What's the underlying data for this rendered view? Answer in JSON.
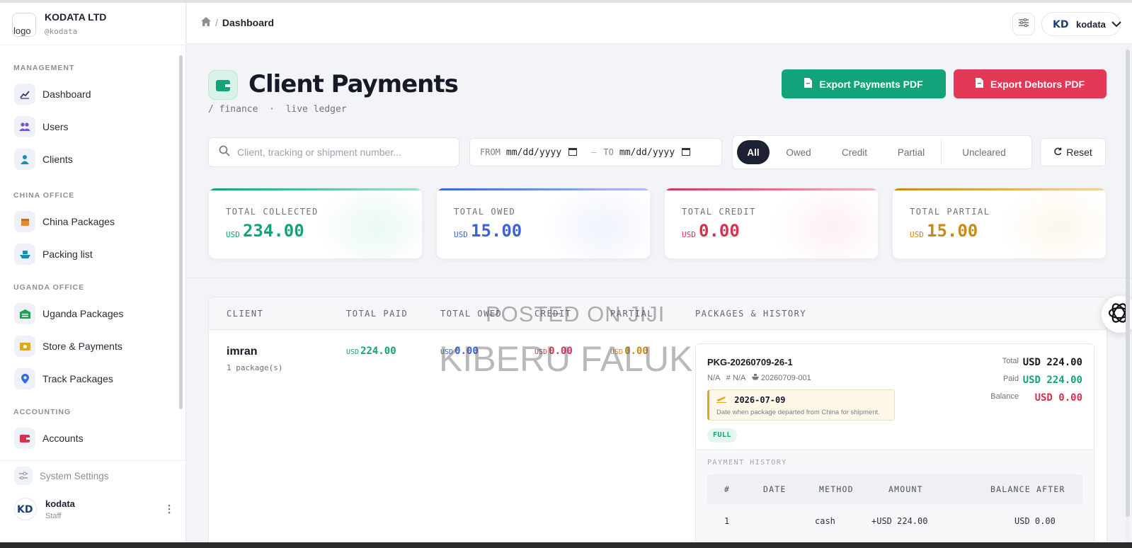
{
  "brand": {
    "logo_alt": "logo",
    "name": "KODATA LTD",
    "handle": "@kodata"
  },
  "sidebar": {
    "sections": [
      "MANAGEMENT",
      "CHINA OFFICE",
      "UGANDA OFFICE",
      "ACCOUNTING"
    ],
    "items": [
      {
        "label": "Dashboard",
        "icon": "chart-line-icon"
      },
      {
        "label": "Users",
        "icon": "users-icon"
      },
      {
        "label": "Clients",
        "icon": "user-icon"
      },
      {
        "label": "China Packages",
        "icon": "box-icon"
      },
      {
        "label": "Packing list",
        "icon": "ship-icon"
      },
      {
        "label": "Uganda Packages",
        "icon": "warehouse-icon"
      },
      {
        "label": "Store & Payments",
        "icon": "money-icon"
      },
      {
        "label": "Track Packages",
        "icon": "location-pin-icon"
      },
      {
        "label": "Accounts",
        "icon": "wallet-icon"
      }
    ],
    "settings_label": "System Settings",
    "user": {
      "name": "kodata",
      "role": "Staff"
    }
  },
  "header": {
    "breadcrumb": "Dashboard",
    "account_name": "kodata"
  },
  "page": {
    "title": "Client Payments",
    "subtitle": "/ finance  ·  live ledger",
    "export_payments": "Export Payments PDF",
    "export_debtors": "Export Debtors PDF"
  },
  "filters": {
    "search_placeholder": "Client, tracking or shipment number...",
    "from_label": "FROM",
    "to_label": "TO",
    "date_placeholder": "mm/dd/yyyy",
    "chips": [
      "All",
      "Owed",
      "Credit",
      "Partial",
      "Uncleared"
    ],
    "active_chip": "All",
    "reset_label": "Reset"
  },
  "stats": [
    {
      "label": "TOTAL COLLECTED",
      "currency": "USD",
      "amount": "234.00",
      "color": "#12a37a"
    },
    {
      "label": "TOTAL OWED",
      "currency": "USD",
      "amount": "15.00",
      "color": "#3b63d6"
    },
    {
      "label": "TOTAL CREDIT",
      "currency": "USD",
      "amount": "0.00",
      "color": "#d6324f"
    },
    {
      "label": "TOTAL PARTIAL",
      "currency": "USD",
      "amount": "15.00",
      "color": "#c98a16"
    }
  ],
  "table": {
    "columns": [
      "CLIENT",
      "TOTAL PAID",
      "TOTAL OWED",
      "CREDIT",
      "PARTIAL",
      "PACKAGES & HISTORY"
    ],
    "rows": [
      {
        "client": "imran",
        "packages": "1 package(s)",
        "paid": "224.00",
        "owed": "0.00",
        "credit": "0.00",
        "partial": "0.00",
        "currency": "USD",
        "package": {
          "id": "PKG-20260709-26-1",
          "meta1": "N/A",
          "meta2": "# N/A",
          "shipment": "20260709-001",
          "departure_date": "2026-07-09",
          "departure_note": "Date when package departed from China for shipment.",
          "status": "FULL",
          "total_label": "Total",
          "total": "USD 224.00",
          "paid_label": "Paid",
          "paid": "USD 224.00",
          "balance_label": "Balance",
          "balance": "USD 0.00",
          "history_title": "PAYMENT HISTORY",
          "history_columns": [
            "#",
            "DATE",
            "METHOD",
            "AMOUNT",
            "BALANCE AFTER"
          ],
          "history": [
            {
              "n": "1",
              "date": "",
              "method": "cash",
              "amount": "+USD 224.00",
              "balance_after": "USD 0.00"
            }
          ]
        }
      }
    ]
  },
  "watermark": {
    "line1": "POSTED ON JIJI",
    "line2": "KIBERU FALUK"
  }
}
